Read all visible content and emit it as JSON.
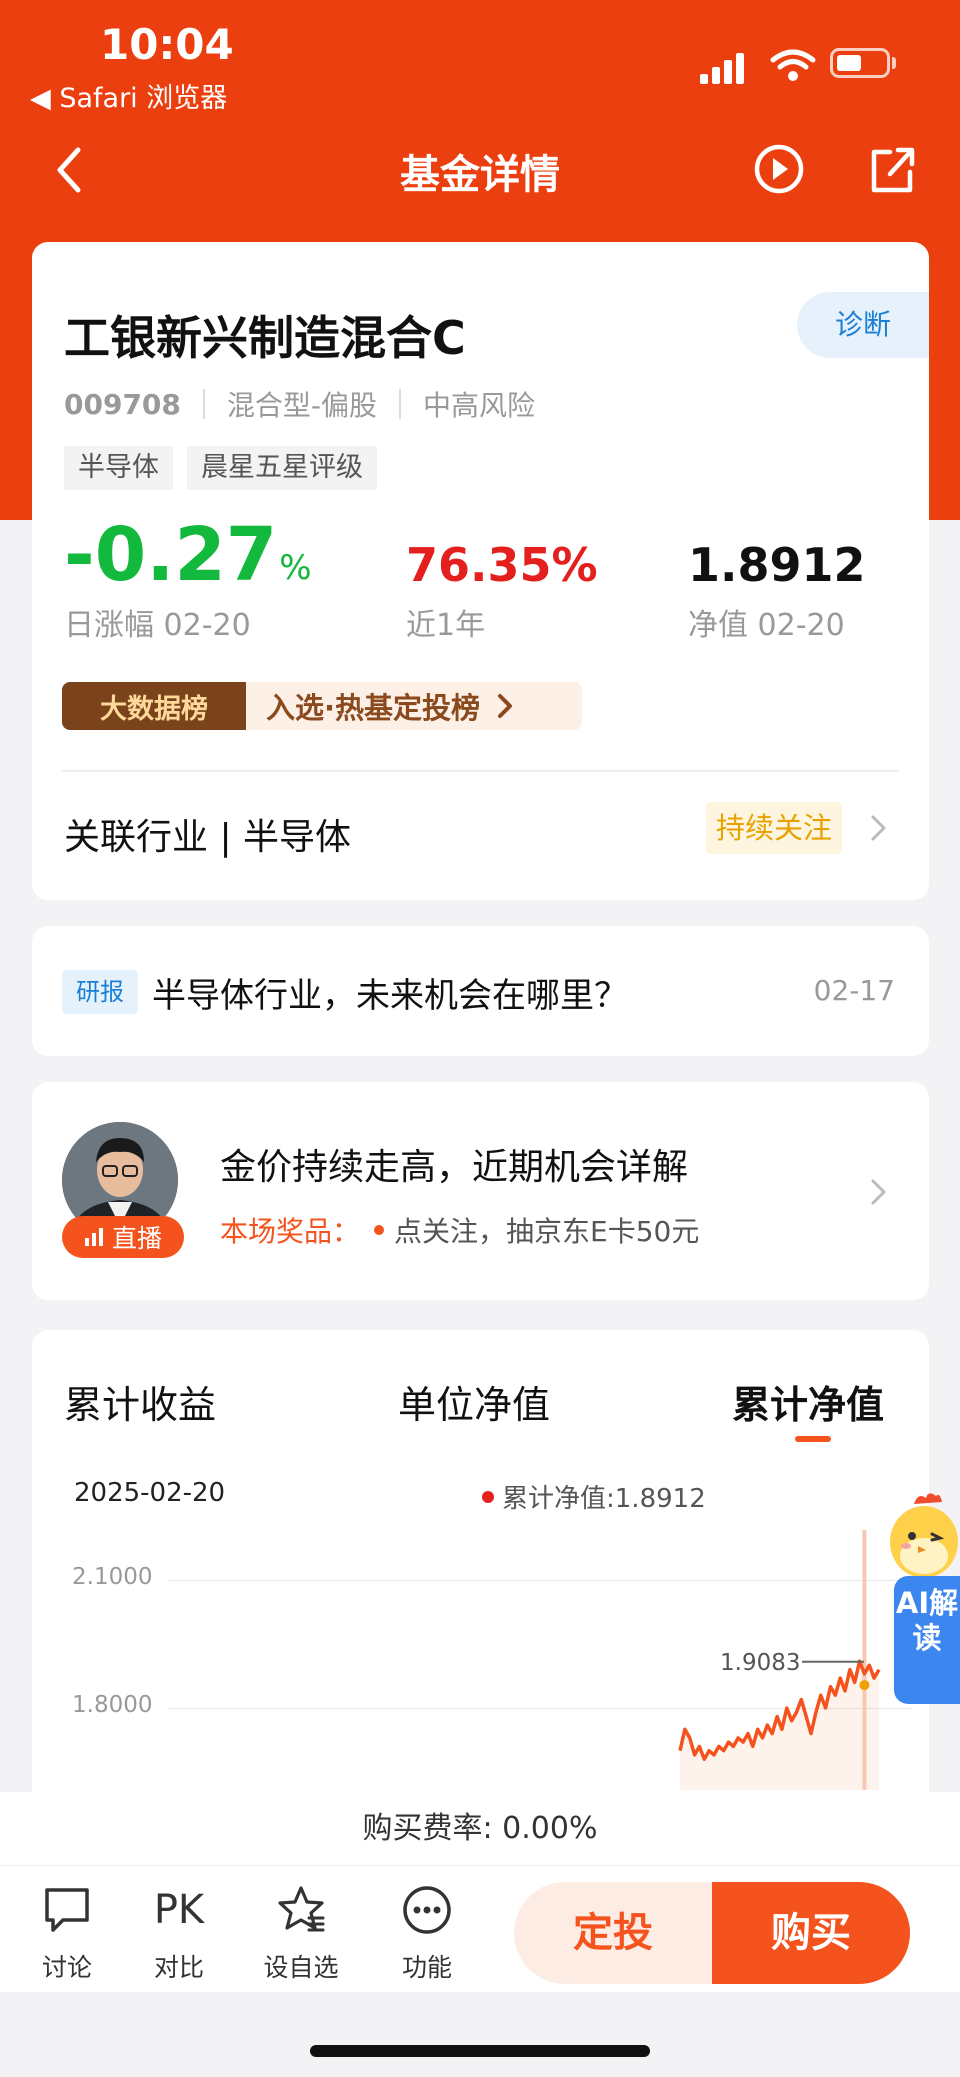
{
  "status_bar": {
    "time": "10:04",
    "back_app": "◀ Safari 浏览器"
  },
  "nav": {
    "title": "基金详情"
  },
  "fund": {
    "name": "工银新兴制造混合C",
    "diagnose": "诊断",
    "code": "009708",
    "type": "混合型-偏股",
    "risk": "中高风险",
    "tags": [
      "半导体",
      "晨星五星评级"
    ],
    "daily_change": "-0.27",
    "daily_change_unit": "%",
    "daily_change_label": "日涨幅 02-20",
    "year_return": "76.35%",
    "year_return_label": "近1年",
    "nav_value": "1.8912",
    "nav_label": "净值 02-20",
    "rank_badge": "大数据榜",
    "rank_text": "入选·热基定投榜",
    "industry_label": "关联行业 | 半导体",
    "follow_tag": "持续关注"
  },
  "research": {
    "tag": "研报",
    "title": "半导体行业，未来机会在哪里？",
    "date": "02-17"
  },
  "live": {
    "title": "金价持续走高，近期机会详解",
    "badge": "直播",
    "prize_label": "本场奖品：",
    "prize_text": "点关注，抽京东E卡50元"
  },
  "chart": {
    "tabs": [
      "累计收益",
      "单位净值",
      "累计净值"
    ],
    "active_tab": 2,
    "date": "2025-02-20",
    "legend_text": "累计净值:1.8912",
    "max_label": "1.9083",
    "colors": {
      "line": "#f4531d",
      "marker": "#e4201f"
    }
  },
  "chart_data": {
    "type": "line",
    "title": "",
    "xlabel": "",
    "ylabel": "",
    "yticks": [
      "2.1000",
      "1.8000"
    ],
    "ylim_visible": [
      1.68,
      2.1
    ],
    "series": [
      {
        "name": "累计净值",
        "values": [
          1.7,
          1.75,
          1.73,
          1.69,
          1.71,
          1.68,
          1.7,
          1.69,
          1.71,
          1.7,
          1.72,
          1.71,
          1.73,
          1.72,
          1.74,
          1.71,
          1.75,
          1.73,
          1.76,
          1.74,
          1.78,
          1.75,
          1.8,
          1.77,
          1.79,
          1.82,
          1.78,
          1.74,
          1.79,
          1.83,
          1.8,
          1.85,
          1.83,
          1.87,
          1.84,
          1.89,
          1.86,
          1.91,
          1.88,
          1.9,
          1.87,
          1.89
        ]
      }
    ],
    "annotated_max": 1.9083,
    "current": 1.8912
  },
  "ai": {
    "label": "AI解读"
  },
  "fee": {
    "text": "购买费率: 0.00%"
  },
  "bottom": {
    "discuss": "讨论",
    "compare_icon": "PK",
    "compare": "对比",
    "watch": "设自选",
    "more": "功能",
    "dingtou": "定投",
    "buy": "购买"
  }
}
